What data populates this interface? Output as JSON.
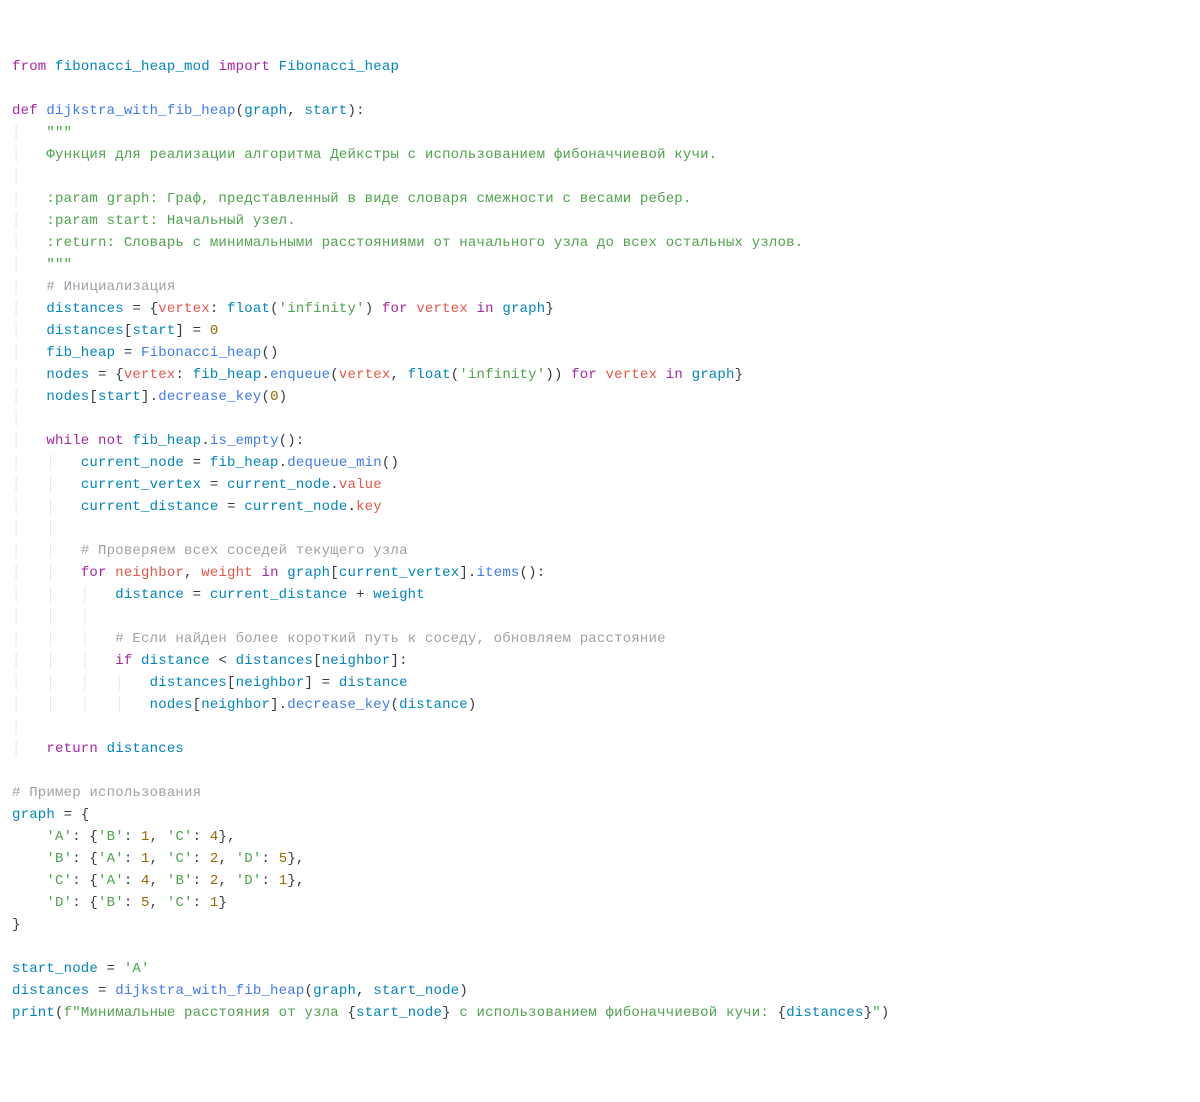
{
  "code": {
    "l1_from": "from",
    "l1_mod": "fibonacci_heap_mod",
    "l1_import": "import",
    "l1_cls": "Fibonacci_heap",
    "l3_def": "def",
    "l3_fn": "dijkstra_with_fib_heap",
    "l3_p1": "graph",
    "l3_p2": "start",
    "doc_open": "\"\"\"",
    "doc_l1": "Функция для реализации алгоритма Дейкстры с использованием фибоначчиевой кучи.",
    "doc_l2": ":param graph: Граф, представленный в виде словаря смежности с весами ребер.",
    "doc_l3": ":param start: Начальный узел.",
    "doc_l4": ":return: Словарь с минимальными расстояниями от начального узла до всех остальных узлов.",
    "doc_close": "\"\"\"",
    "cm_init": "# Инициализация",
    "distances": "distances",
    "vertex": "vertex",
    "float": "float",
    "inf": "'infinity'",
    "for": "for",
    "in": "in",
    "graph": "graph",
    "start": "start",
    "zero": "0",
    "fib_heap": "fib_heap",
    "Fibonacci_heap": "Fibonacci_heap",
    "nodes": "nodes",
    "enqueue": "enqueue",
    "decrease_key": "decrease_key",
    "while": "while",
    "not": "not",
    "is_empty": "is_empty",
    "current_node": "current_node",
    "dequeue_min": "dequeue_min",
    "current_vertex": "current_vertex",
    "value": "value",
    "current_distance": "current_distance",
    "key": "key",
    "cm_neighbors": "# Проверяем всех соседей текущего узла",
    "neighbor": "neighbor",
    "weight": "weight",
    "items": "items",
    "distance": "distance",
    "cm_shorter": "# Если найден более короткий путь к соседу, обновляем расстояние",
    "if": "if",
    "return": "return",
    "cm_example": "# Пример использования",
    "graphvar": "graph",
    "A": "'A'",
    "B": "'B'",
    "C": "'C'",
    "D": "'D'",
    "n1": "1",
    "n2": "2",
    "n4": "4",
    "n5": "5",
    "start_node": "start_node",
    "print": "print",
    "fstr_prefix": "f\"Минимальные расстояния от узла ",
    "fstr_mid": " с использованием фибоначчиевой кучи: ",
    "fstr_end": "\""
  }
}
